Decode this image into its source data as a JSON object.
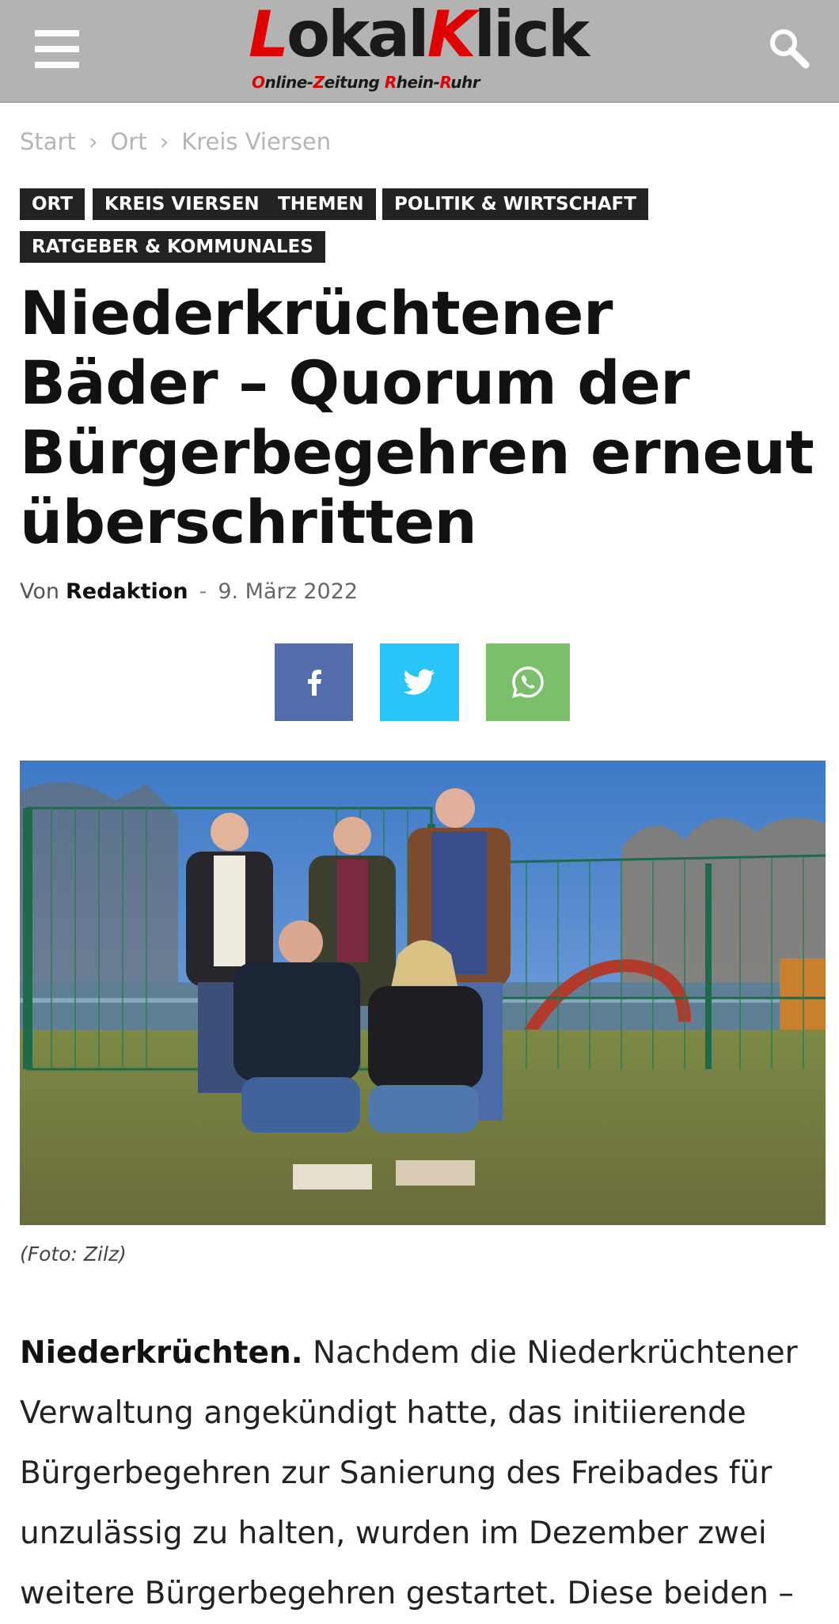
{
  "header": {
    "logo_first_letter": "L",
    "logo_middle": "okal",
    "logo_second_letter": "K",
    "logo_end": "lick",
    "tagline_parts": [
      "O",
      "nline-",
      "Z",
      "eitung ",
      "R",
      "hein-",
      "R",
      "uhr"
    ],
    "menu_icon": "hamburger-menu-icon",
    "search_icon": "search-icon"
  },
  "breadcrumb": {
    "items": [
      "Start",
      "Ort",
      "Kreis Viersen"
    ],
    "separator": "›"
  },
  "tags": [
    "ORT",
    "KREIS VIERSEN",
    "THEMEN",
    "POLITIK & WIRTSCHAFT",
    "RATGEBER & KOMMUNALES"
  ],
  "article": {
    "title": "Niederkrüchtener Bäder – Quorum der Bürgerbegehren erneut überschritten",
    "by_label": "Von",
    "author": "Redaktion",
    "dash": "-",
    "date": "9. März 2022",
    "caption": "(Foto: Zilz)",
    "lead": "Niederkrüchten.",
    "body_lines": [
      "Nachdem die Niederkrüchtener",
      "Verwaltung angekündigt hatte, das initiierende",
      "Bürgerbegehren zur Sanierung des Freibades für",
      "unzulässig zu halten, wurden im Dezember zwei",
      "weitere Bürgerbegehren gestartet. Diese beiden –"
    ]
  },
  "share": {
    "facebook_icon": "facebook-icon",
    "twitter_icon": "twitter-icon",
    "whatsapp_icon": "whatsapp-icon"
  },
  "colors": {
    "header_bg": "#b3b3b3",
    "logo_red": "#e00000",
    "tag_bg": "#222222",
    "facebook": "#516eab",
    "twitter": "#29c5f6",
    "whatsapp": "#7bbf6a"
  }
}
